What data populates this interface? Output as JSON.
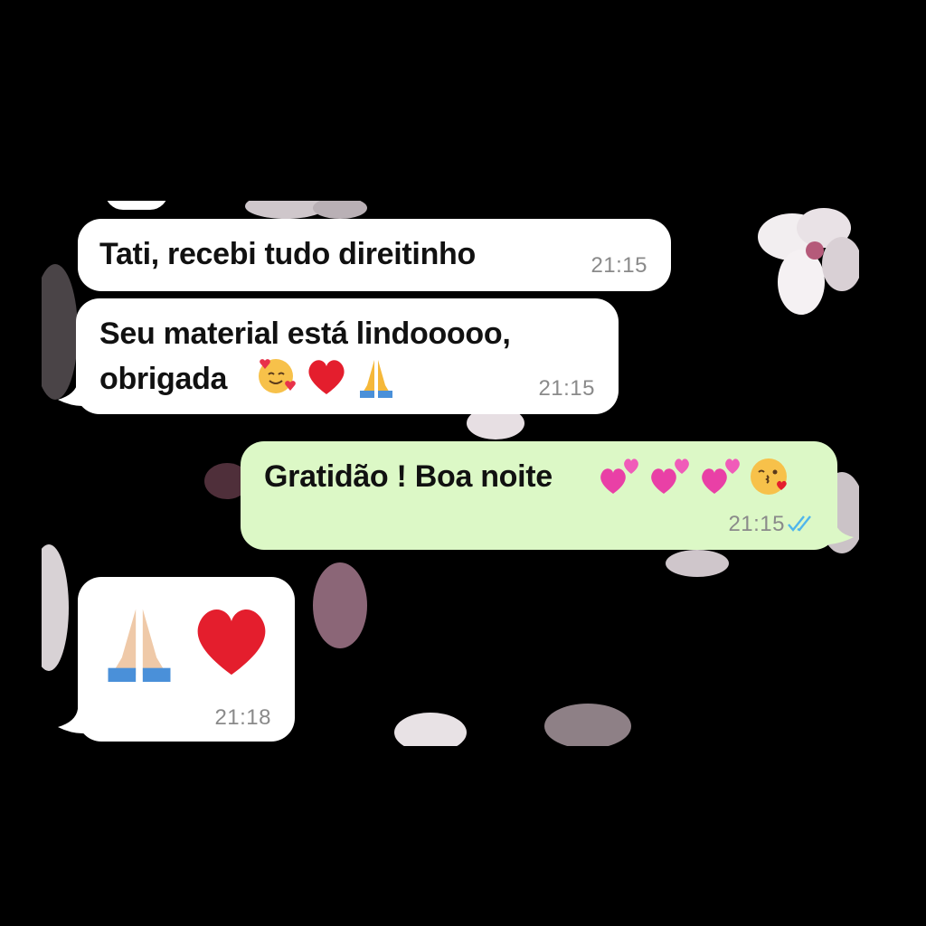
{
  "chat": {
    "messages": [
      {
        "direction": "incoming",
        "text": "Tati, recebi tudo direitinho",
        "time": "21:15"
      },
      {
        "direction": "incoming",
        "line1": "Seu material está lindooooo,",
        "line2": "obrigada",
        "emojis": [
          "smiling-face-with-hearts",
          "red-heart",
          "folded-hands"
        ],
        "time": "21:15"
      },
      {
        "direction": "outgoing",
        "text": "Gratidão ! Boa noite",
        "emojis": [
          "two-hearts",
          "two-hearts",
          "two-hearts",
          "face-blowing-kiss"
        ],
        "time": "21:15",
        "status": "read",
        "status_icon": "double-check-icon"
      },
      {
        "direction": "incoming",
        "emojis": [
          "folded-hands",
          "red-heart"
        ],
        "time": "21:18"
      }
    ]
  },
  "colors": {
    "incoming_bubble": "#ffffff",
    "outgoing_bubble": "#dcf8c6",
    "read_ticks": "#4fb6ec",
    "timestamp": "#8a8a8a",
    "wallpaper": "#000000"
  }
}
